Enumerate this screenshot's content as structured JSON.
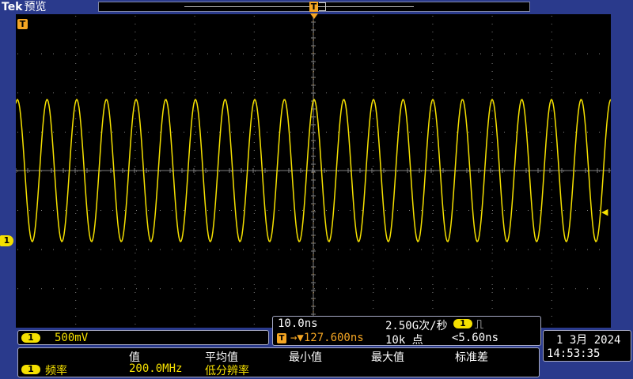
{
  "top_bar": {
    "logo": "Tek",
    "mode": "预览",
    "trigger_marker": "T"
  },
  "screen": {
    "trigger_position_marker": "T",
    "channel_marker": "1",
    "trigger_level_marker": "◀",
    "waveform_color": "#f5e000",
    "grid_color": "#808080",
    "trigger_color": "#f5a623"
  },
  "channel1": {
    "badge": "1",
    "scale": "500mV"
  },
  "horizontal": {
    "time_scale": "10.0ns",
    "sample_rate": "2.50G次/秒",
    "trigger_badge": "T",
    "trigger_delay": "→▼127.600ns",
    "record_length": "10k 点",
    "trigger_channel": "1",
    "trigger_slope_icon": "rising-pulse-icon",
    "trigger_slope_glyph": "⎍",
    "trigger_level": "<5.60ns"
  },
  "clock": {
    "date": "1 3月  2024",
    "time": "14:53:35"
  },
  "measurements": {
    "headers": [
      "值",
      "平均值",
      "最小值",
      "最大值",
      "标准差"
    ],
    "rows": [
      {
        "channel": "1",
        "name": "频率",
        "value": "200.0MHz",
        "note": "低分辨率"
      }
    ]
  }
}
